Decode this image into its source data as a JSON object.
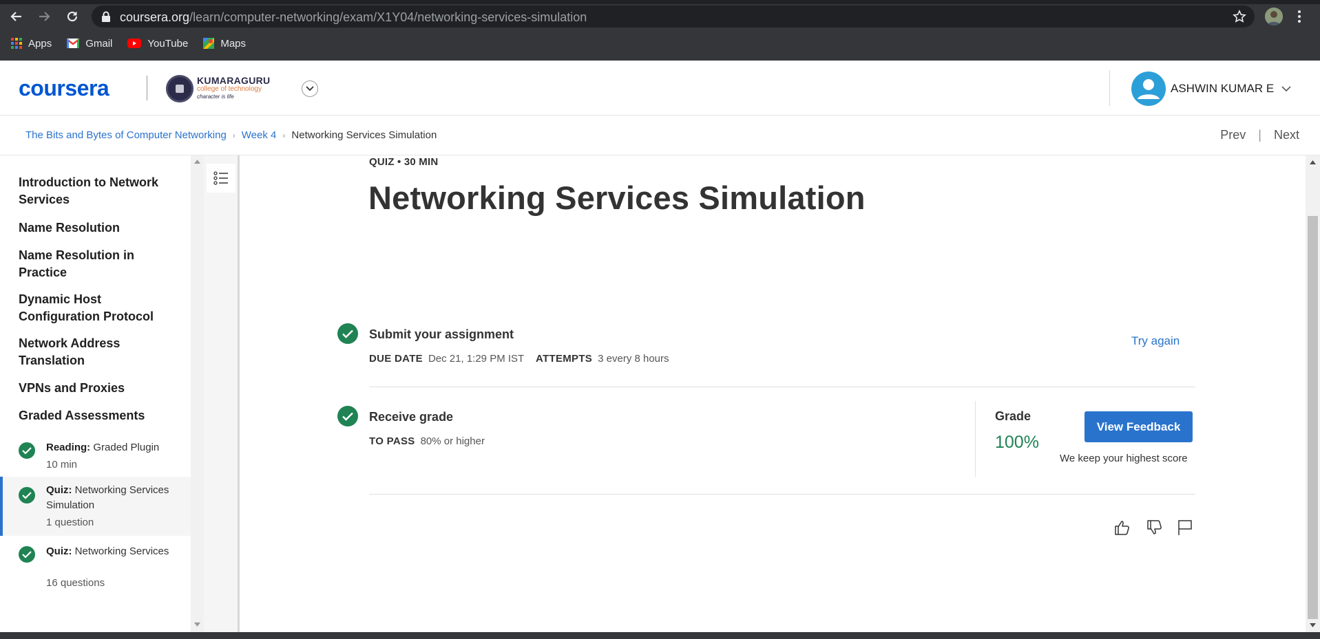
{
  "browser": {
    "url_host": "coursera.org",
    "url_path": "/learn/computer-networking/exam/X1Y04/networking-services-simulation",
    "bookmarks": [
      {
        "label": "Apps",
        "icon": "apps-grid-icon"
      },
      {
        "label": "Gmail",
        "icon": "gmail-icon"
      },
      {
        "label": "YouTube",
        "icon": "youtube-icon"
      },
      {
        "label": "Maps",
        "icon": "maps-icon"
      }
    ]
  },
  "header": {
    "logo": "coursera",
    "partner": {
      "name": "KUMARAGURU",
      "subtitle": "college of technology",
      "tagline": "character is life"
    },
    "user_name": "ASHWIN KUMAR E"
  },
  "breadcrumb": {
    "items": [
      "The Bits and Bytes of Computer Networking",
      "Week 4",
      "Networking Services Simulation"
    ],
    "prev": "Prev",
    "next": "Next"
  },
  "sidebar": {
    "sections": [
      "Introduction to Network Services",
      "Name Resolution",
      "Name Resolution in Practice",
      "Dynamic Host Configuration Protocol",
      "Network Address Translation",
      "VPNs and Proxies",
      "Graded Assessments"
    ],
    "items": [
      {
        "type": "Reading:",
        "title": "Graded Plugin",
        "meta": "10 min",
        "completed": true,
        "active": false
      },
      {
        "type": "Quiz:",
        "title": "Networking Services Simulation",
        "meta": "1 question",
        "completed": true,
        "active": true
      },
      {
        "type": "Quiz:",
        "title": "Networking Services",
        "meta": "16 questions",
        "completed": true,
        "active": false
      }
    ]
  },
  "main": {
    "quiz_label": "QUIZ • 30 MIN",
    "title": "Networking Services Simulation",
    "submit": {
      "title": "Submit your assignment",
      "due_label": "DUE DATE",
      "due_value": "Dec 21, 1:29 PM IST",
      "attempts_label": "ATTEMPTS",
      "attempts_value": "3 every 8 hours",
      "action": "Try again"
    },
    "receive": {
      "title": "Receive grade",
      "pass_label": "TO PASS",
      "pass_value": "80% or higher",
      "grade_label": "Grade",
      "grade_value": "100%",
      "feedback_button": "View Feedback",
      "note": "We keep your highest score"
    }
  },
  "colors": {
    "accent": "#2a73cc",
    "brand": "#0056d2",
    "success": "#1f8354"
  }
}
